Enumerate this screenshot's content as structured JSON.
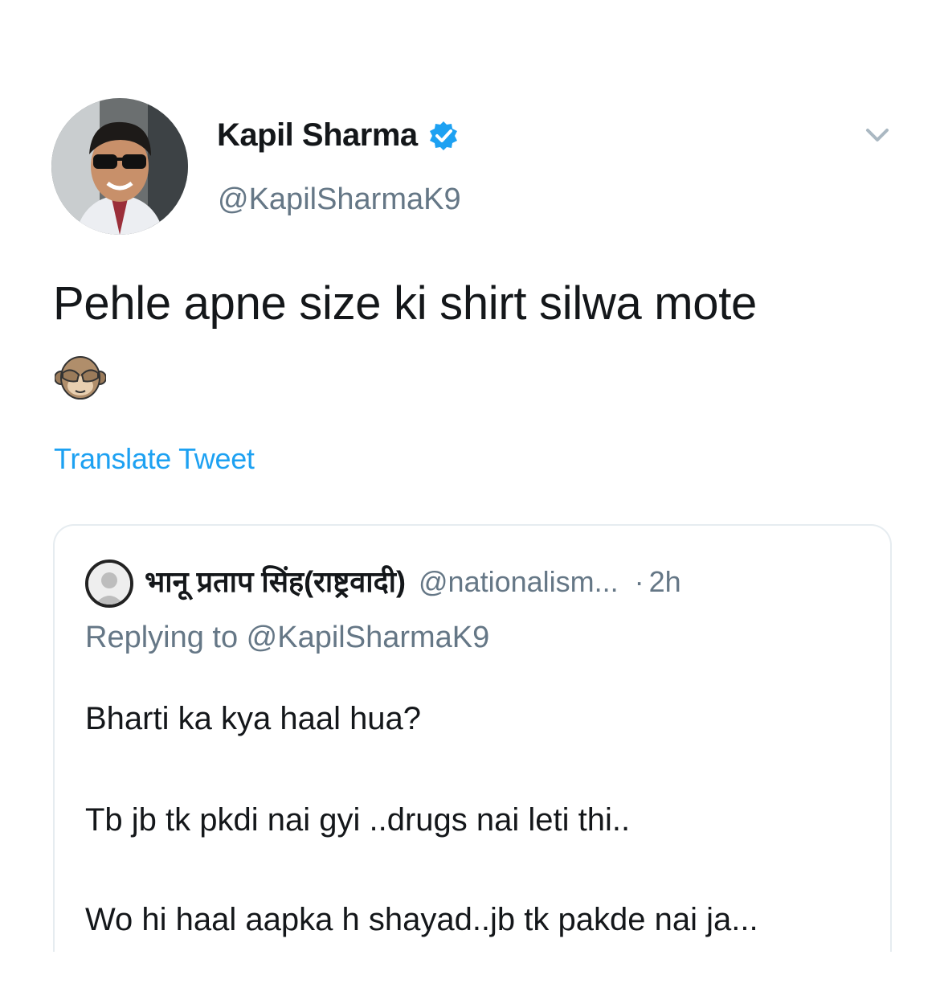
{
  "tweet": {
    "author_name": "Kapil Sharma",
    "author_handle": "@KapilSharmaK9",
    "text": "Pehle apne size ki shirt silwa mote",
    "emoji_icon": "see-no-evil-monkey-icon",
    "translate_label": "Translate Tweet",
    "verified_icon": "verified-badge-icon",
    "menu_icon": "chevron-down-icon"
  },
  "quoted_tweet": {
    "author_name": "भानू प्रताप सिंह(राष्ट्रवादी)",
    "author_handle": "@nationalism...",
    "separator": "·",
    "time": "2h",
    "replying_to": "Replying to @KapilSharmaK9",
    "lines": [
      "Bharti ka kya haal hua?",
      "Tb jb tk pkdi nai gyi ..drugs nai leti thi..",
      "Wo hi haal aapka h shayad..jb tk pakde nai ja..."
    ]
  },
  "colors": {
    "accent": "#1da1f2",
    "text": "#14171a",
    "secondary": "#657786",
    "border": "#e6ecf0"
  }
}
